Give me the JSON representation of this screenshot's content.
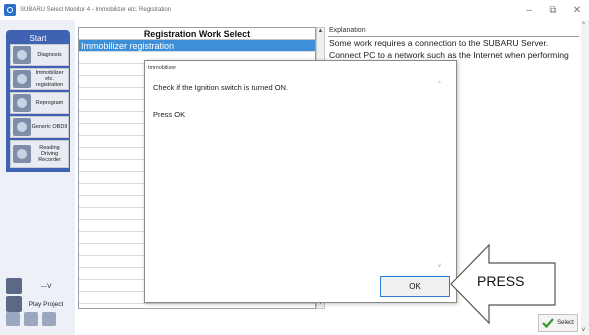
{
  "window": {
    "title": "SUBARU Select Monitor 4 - Immobilizer etc. Registration",
    "minimize_glyph": "–",
    "restore_glyph": "⧉",
    "close_glyph": "✕"
  },
  "sidebar": {
    "start_label": "Start",
    "items": [
      {
        "label": "Diagnosis",
        "icon": "diagnosis-icon"
      },
      {
        "label": "Immobilizer etc. registration",
        "icon": "immobilizer-icon"
      },
      {
        "label": "Reprogram",
        "icon": "reprogram-icon"
      },
      {
        "label": "Generic OBDII",
        "icon": "obd-icon"
      },
      {
        "label": "Reading Driving Recorder",
        "icon": "recorder-icon"
      }
    ],
    "vehicle_label": "---V",
    "play_project_label": "Play Project"
  },
  "list": {
    "header": "Registration Work Select",
    "rows": [
      "Immobilizer registration",
      "",
      "",
      "",
      "",
      "",
      "",
      "",
      "",
      "",
      "",
      "",
      "",
      "",
      "",
      "",
      "",
      "",
      "",
      "",
      "",
      ""
    ]
  },
  "explanation": {
    "heading": "Explanation",
    "lines": [
      "Some work requires a connection to the SUBARU Server.",
      "Connect PC to a network such as the Internet when performing"
    ]
  },
  "dialog": {
    "title": "Immobilizer",
    "message": "Check if the Ignition switch is turned ON.",
    "instruction": "Press OK",
    "ok_label": "OK"
  },
  "callout": {
    "text": "PRESS"
  },
  "select_button": {
    "label": "Select"
  },
  "colors": {
    "sidebar_panel": "#3f63b2",
    "selected_row": "#3d8fd8",
    "ok_border": "#2f7bd6"
  }
}
